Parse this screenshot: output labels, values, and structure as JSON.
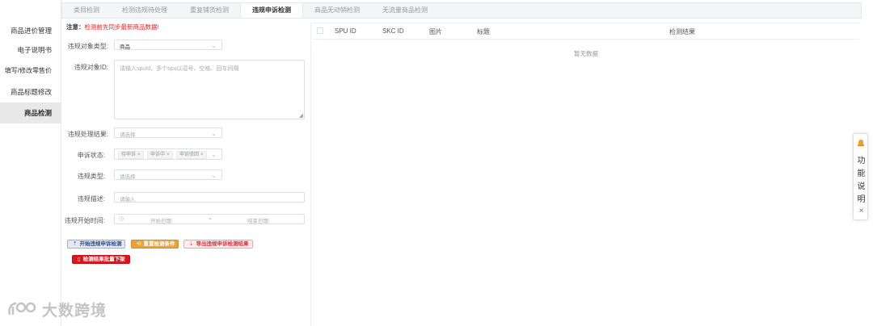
{
  "sidebar": {
    "items": [
      {
        "label": "商品进价管理",
        "active": false
      },
      {
        "label": "电子说明书",
        "active": false
      },
      {
        "label": "填写/修改零售价",
        "active": false
      },
      {
        "label": "商品标题修改",
        "active": false
      },
      {
        "label": "商品检测",
        "active": true
      }
    ],
    "watermark": "大数跨境"
  },
  "tabs": [
    {
      "label": "类目检测",
      "active": false
    },
    {
      "label": "检测违规待处理",
      "active": false
    },
    {
      "label": "重复铺货检测",
      "active": false
    },
    {
      "label": "违规申诉检测",
      "active": true
    },
    {
      "label": "商品无动销检测",
      "active": false
    },
    {
      "label": "无流量商品检测",
      "active": false
    }
  ],
  "notice": {
    "label": "注意：",
    "text": "检测前先同步最新商品数据!"
  },
  "form": {
    "target_type": {
      "label": "违规对象类型:",
      "value": "商品"
    },
    "target_id": {
      "label": "违规对象ID:",
      "placeholder": "请输入spuId，多个spu以逗号、空格、回车间隔"
    },
    "result": {
      "label": "违规处理结果:",
      "placeholder": "请选择"
    },
    "appeal_status": {
      "label": "申诉状态:",
      "tags": [
        "待申诉",
        "申诉中",
        "申诉驳回"
      ]
    },
    "violation_type": {
      "label": "违规类型:",
      "placeholder": "请选择"
    },
    "description": {
      "label": "违规描述:",
      "placeholder": "请输入"
    },
    "start_time": {
      "label": "违规开始时间:",
      "start_placeholder": "开始日期",
      "separator": "~",
      "end_placeholder": "结束日期"
    }
  },
  "buttons": {
    "start": "开始违规申诉检测",
    "reset": "重置检测条件",
    "export": "导出违规申诉检测结果",
    "offline": "检测结果批量下架"
  },
  "table": {
    "columns": [
      "SPU ID",
      "SKC ID",
      "图片",
      "标题",
      "检测结果"
    ],
    "empty_text": "暂无数据"
  },
  "help": {
    "chars": [
      "功",
      "能",
      "说",
      "明"
    ],
    "close": "×"
  },
  "colors": {
    "accent_red": "#e02020",
    "warning": "#e6a23c",
    "danger": "#d9161f"
  }
}
